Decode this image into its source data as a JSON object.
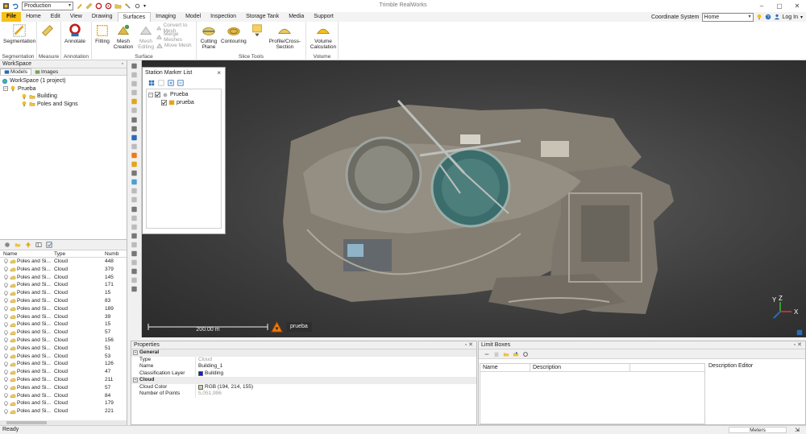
{
  "titlebar": {
    "project_select": "Production",
    "app_title": "Trimble RealWorks"
  },
  "tabs": [
    {
      "label": "File",
      "kind": "file"
    },
    {
      "label": "Home"
    },
    {
      "label": "Edit"
    },
    {
      "label": "View"
    },
    {
      "label": "Drawing"
    },
    {
      "label": "Surfaces",
      "active": true
    },
    {
      "label": "Imaging"
    },
    {
      "label": "Model"
    },
    {
      "label": "Inspection"
    },
    {
      "label": "Storage Tank"
    },
    {
      "label": "Media"
    },
    {
      "label": "Support"
    }
  ],
  "tabright": {
    "coord_label": "Coordinate System",
    "coord_value": "Home",
    "login": "Log In"
  },
  "ribbon": {
    "segmentation_btn": "Segmentation",
    "segmentation_group": "Segmentation",
    "measure_group": "Measure",
    "annotate_btn": "Annotate",
    "annotation_group": "Annotation",
    "fitting_btn": "Fitting",
    "mesh_creation_btn": "Mesh Creation",
    "mesh_editing_btn": "Mesh Editing",
    "convert_to_mesh": "Convert to Mesh",
    "merge_meshes": "Merge Meshes",
    "move_mesh": "Move Mesh",
    "surface_group": "Surface",
    "cutting_plane_btn": "Cutting Plane",
    "contouring_btn": "Contouring",
    "profile_btn": "Profile/Cross-Section",
    "slice_group": "Slice Tools",
    "volume_btn": "Volume Calculation",
    "volume_group": "Volume"
  },
  "workspace": {
    "title": "WorkSpace",
    "pin": "▫",
    "tab_models": "Models",
    "tab_images": "Images",
    "root": "WorkSpace  (1 project)",
    "project": "Prueba",
    "child1": "Building",
    "child2": "Poles and Signs"
  },
  "objtable": {
    "headers": [
      "Name",
      "Type",
      "Numb"
    ],
    "rows": [
      [
        "Poles and Si...",
        "Cloud",
        "448"
      ],
      [
        "Poles and Si...",
        "Cloud",
        "379"
      ],
      [
        "Poles and Si...",
        "Cloud",
        "145"
      ],
      [
        "Poles and Si...",
        "Cloud",
        "171"
      ],
      [
        "Poles and Si...",
        "Cloud",
        "15"
      ],
      [
        "Poles and Si...",
        "Cloud",
        "83"
      ],
      [
        "Poles and Si...",
        "Cloud",
        "189"
      ],
      [
        "Poles and Si...",
        "Cloud",
        "39"
      ],
      [
        "Poles and Si...",
        "Cloud",
        "15"
      ],
      [
        "Poles and Si...",
        "Cloud",
        "57"
      ],
      [
        "Poles and Si...",
        "Cloud",
        "156"
      ],
      [
        "Poles and Si...",
        "Cloud",
        "51"
      ],
      [
        "Poles and Si...",
        "Cloud",
        "53"
      ],
      [
        "Poles and Si...",
        "Cloud",
        "126"
      ],
      [
        "Poles and Si...",
        "Cloud",
        "47"
      ],
      [
        "Poles and Si...",
        "Cloud",
        "211"
      ],
      [
        "Poles and Si...",
        "Cloud",
        "57"
      ],
      [
        "Poles and Si...",
        "Cloud",
        "84"
      ],
      [
        "Poles and Si...",
        "Cloud",
        "179"
      ],
      [
        "Poles and Si...",
        "Cloud",
        "221"
      ]
    ]
  },
  "station_marker": {
    "title": "Station Marker List",
    "close": "×",
    "root": "Prueba",
    "child": "prueba"
  },
  "viewport": {
    "scale_text": "200.00 m",
    "marker_label": "prueba",
    "axis_y": "Y",
    "axis_z": "Z",
    "axis_x": "X"
  },
  "properties": {
    "title": "Properties",
    "cat_general": "General",
    "type_k": "Type",
    "type_v": "Cloud",
    "name_k": "Name",
    "name_v": "Building_1",
    "class_k": "Classification Layer",
    "class_v": "Building",
    "cat_cloud": "Cloud",
    "color_k": "Cloud Color",
    "color_v": "RGB (194, 214, 155)",
    "points_k": "Number of Points",
    "points_v": "5,051,996"
  },
  "limits": {
    "title": "Limit Boxes",
    "col_name": "Name",
    "col_desc": "Description",
    "desc_editor": "Description Editor"
  },
  "status": {
    "text": "Ready",
    "units": "Meters"
  },
  "colors": {
    "file_tab": "#f6c018",
    "class_layer": "#1020c0",
    "cloud_color": "#c2d69b",
    "folder": "#f0c040"
  }
}
